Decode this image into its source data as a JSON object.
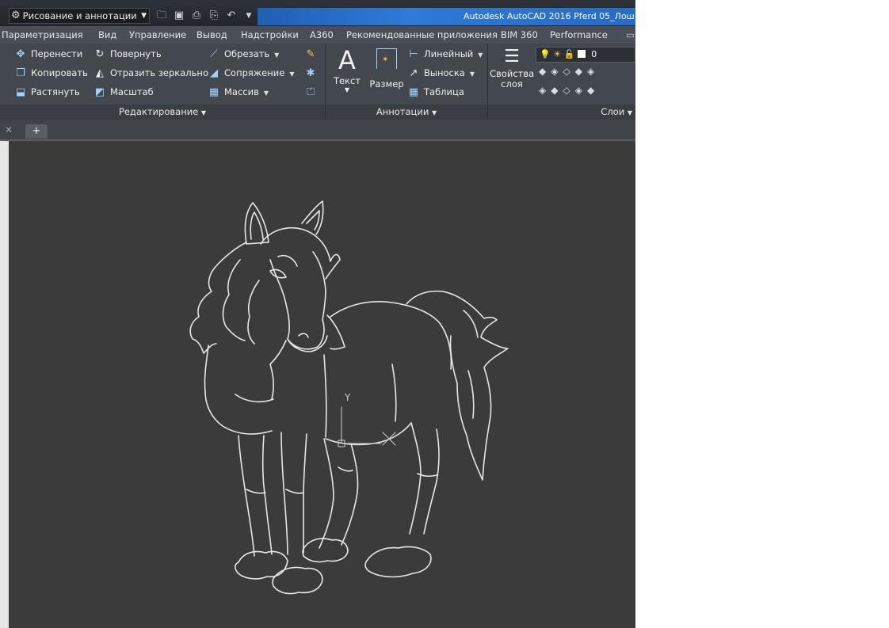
{
  "titlebar": {
    "workspace": "Рисование и аннотации",
    "app_title": "Autodesk AutoCAD 2016   Pferd 05_Лош"
  },
  "menu": {
    "tabs": [
      "Параметризация",
      "Вид",
      "Управление",
      "Вывод",
      "Надстройки",
      "A360",
      "Рекомендованные приложения",
      "BIM 360",
      "Performance"
    ]
  },
  "ribbon": {
    "edit": {
      "move": "Перенести",
      "rotate": "Повернуть",
      "trim": "Обрезать",
      "copy": "Копировать",
      "mirror": "Отразить зеркально",
      "fillet": "Сопряжение",
      "stretch": "Растянуть",
      "scale": "Масштаб",
      "array": "Массив",
      "panel_title": "Редактирование"
    },
    "annotation": {
      "text": "Текст",
      "dimension": "Размер",
      "linear": "Линейный",
      "leader": "Выноска",
      "table": "Таблица",
      "panel_title": "Аннотации"
    },
    "layers": {
      "properties_line1": "Свойства",
      "properties_line2": "слоя",
      "current_layer": "0",
      "panel_title": "Слои"
    }
  },
  "drawing": {
    "ucs_y_label": "Y"
  },
  "colors": {
    "background": "#3b3b3b",
    "line": "#e6e6e6",
    "title_blue": "#2f7ad6"
  }
}
